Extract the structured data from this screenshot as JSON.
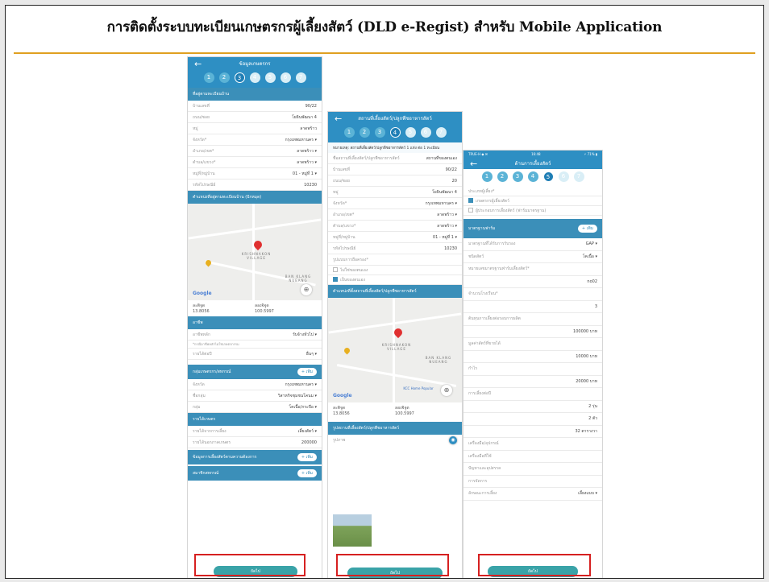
{
  "title": "การติดตั้งระบบทะเบียนเกษตรกรผู้เลี้ยงสัตว์ (DLD e-Regist) สำหรับ Mobile Application",
  "colors": {
    "accent": "#2e8fc3",
    "rule": "#e0a020",
    "highlight": "#d62020",
    "cta": "#3aa3a8"
  },
  "phone1": {
    "header": "ข้อมูลเกษตรกร",
    "steps": [
      "1",
      "2",
      "3",
      "4",
      "5",
      "6",
      "7"
    ],
    "current_step": 3,
    "section_address": "ที่อยู่ตามทะเบียนบ้าน",
    "fields": [
      {
        "label": "บ้านเลขที่",
        "value": "90/22"
      },
      {
        "label": "ถนน/ซอย",
        "value": "โยธินพัฒนา 4"
      },
      {
        "label": "หมู่",
        "value": "ลาดพร้าว"
      },
      {
        "label": "จังหวัด*",
        "value": "กรุงเทพมหานคร ▾"
      },
      {
        "label": "อำเภอ/เขต*",
        "value": "ลาดพร้าว ▾"
      },
      {
        "label": "ตำบล/แขวง*",
        "value": "ลาดพร้าว ▾"
      },
      {
        "label": "หมู่ที่/หมู่บ้าน",
        "value": "01 - หมู่ที่ 1 ▾"
      },
      {
        "label": "รหัสไปรษณีย์",
        "value": "10230"
      }
    ],
    "section_map": "ตำแหน่งที่อยู่ตามทะเบียนบ้าน (ปักหมุด)",
    "map_label": "KRISHNAKON VILLAGE",
    "map_label2": "BAN KLANG NUEANG",
    "google": "Google",
    "lat_label": "ละติจูด",
    "lat": "13.8056",
    "lng_label": "ลองจิจูด",
    "lng": "100.5997",
    "section_other": "อาชีพ",
    "f_job": {
      "label": "อาชีพหลัก",
      "value": "รับจ้างทั่วไป ▾"
    },
    "f_job_note": "*กรณีอาชีพหลักไม่ใช่เกษตรกรรม",
    "f_income": {
      "label": "รายได้ต่อปี",
      "value": "อื่นๆ ▾"
    },
    "section_group": "กลุ่มเกษตรกร/สหกรณ์",
    "add_label": "+ เพิ่ม",
    "fields2": [
      {
        "label": "จังหวัด",
        "value": "กรุงเทพมหานคร ▾"
      },
      {
        "label": "ชื่อกลุ่ม",
        "value": "วิสาหกิจชุมชนโคนม ▾"
      },
      {
        "label": "กลุ่ม",
        "value": "โคเนื้อ/กระบือ ▾"
      }
    ],
    "section_income": "รายได้เกษตร",
    "fields3": [
      {
        "label": "รายได้จากการเลี้ยง",
        "value": "เลี้ยงสัตว์ ▾"
      },
      {
        "label": "รายได้นอกภาคเกษตร",
        "value": "200000"
      }
    ],
    "section_more1": "ข้อมูลการเลี้ยงสัตว์ตามความต้องการ",
    "section_more2": "สมาชิกสหกรณ์",
    "cta": "ถัดไป"
  },
  "phone2": {
    "header": "สถานที่เลี้ยงสัตว์/ปลูกพืชอาหารสัตว์",
    "steps": [
      "1",
      "2",
      "3",
      "4",
      "5",
      "6",
      "7"
    ],
    "current_step": 4,
    "note": "หมายเหตุ: สถานที่เลี้ยงสัตว์/ปลูกพืชอาหารสัตว์ 1 แห่ง ต่อ 1 ทะเบียน",
    "f_type": {
      "label": "ชื่อสถานที่เลี้ยงสัตว์/ปลูกพืชอาหารสัตว์",
      "value": "สถานที่ของตนเอง"
    },
    "fields": [
      {
        "label": "บ้านเลขที่",
        "value": "90/22"
      },
      {
        "label": "ถนน/ซอย",
        "value": "20"
      },
      {
        "label": "หมู่",
        "value": "โยธินพัฒนา 4"
      },
      {
        "label": "จังหวัด*",
        "value": "กรุงเทพมหานคร ▾"
      },
      {
        "label": "อำเภอ/เขต*",
        "value": "ลาดพร้าว ▾"
      },
      {
        "label": "ตำบล/แขวง*",
        "value": "ลาดพร้าว ▾"
      },
      {
        "label": "หมู่ที่/หมู่บ้าน",
        "value": "01 - หมู่ที่ 1 ▾"
      },
      {
        "label": "รหัสไปรษณีย์",
        "value": "10230"
      }
    ],
    "f_owner": "รูปแบบการถือครอง*",
    "opt1": "ไม่ใช่ของตนเอง",
    "opt2": "เป็นของตนเอง",
    "section_map": "ตำแหน่งที่ตั้งสถานที่เลี้ยงสัตว์/ปลูกพืชอาหารสัตว์",
    "map_label": "KRISHNAKON VILLAGE",
    "map_label2": "BAN KLANG NUEANG",
    "map_poi": "KCC Home Popular",
    "google": "Google",
    "lat_label": "ละติจูด",
    "lat": "13.8056",
    "lng_label": "ลองจิจูด",
    "lng": "100.5997",
    "section_photo": "รูปสถานที่เลี้ยงสัตว์/ปลูกพืชอาหารสัตว์",
    "photo_label": "รูปภาพ",
    "cta": "ถัดไป"
  },
  "phone3": {
    "statusbar_left": "TRUE-H ◆ ✉",
    "statusbar_time": "16:48",
    "statusbar_right": "⚡ 71% ▮",
    "header": "ด้านการเลี้ยงสัตว์",
    "steps": [
      "1",
      "2",
      "3",
      "4",
      "5",
      "6",
      "7"
    ],
    "current_step": 5,
    "f_kind": "ประเภทผู้เลี้ยง*",
    "opt1": "เกษตรกรผู้เลี้ยงสัตว์",
    "opt2": "ผู้ประกอบการเลี้ยงสัตว์ (ฟาร์มมาตรฐาน)",
    "section_std": "มาตรฐานฟาร์ม",
    "add_label": "+ เพิ่ม",
    "fields": [
      {
        "label": "มาตรฐานที่ได้รับการรับรอง",
        "value": "GAP ▾"
      },
      {
        "label": "ชนิดสัตว์",
        "value": "โคเนื้อ ▾"
      },
      {
        "label": "หมายเลขมาตรฐานฟาร์มเลี้ยงสัตว์*",
        "value": ""
      },
      {
        "label": "",
        "value": "no02"
      },
      {
        "label": "จำนวนโรงเรือน*",
        "value": ""
      },
      {
        "label": "",
        "value": "3"
      },
      {
        "label": "ต้นทุนการเลี้ยงต่อรอบการผลิต",
        "value": ""
      },
      {
        "label": "",
        "value": "100000  บาท"
      },
      {
        "label": "มูลค่าสัตว์ที่ขายได้",
        "value": ""
      },
      {
        "label": "",
        "value": "10000  บาท"
      },
      {
        "label": "กำไร",
        "value": ""
      },
      {
        "label": "",
        "value": "20000  บาท"
      },
      {
        "label": "การเลี้ยงต่อปี",
        "value": ""
      },
      {
        "label": "",
        "value": "2  รุ่น"
      },
      {
        "label": "",
        "value": "2  ตัว"
      },
      {
        "label": "",
        "value": "32  ตารางวา"
      },
      {
        "label": "เครื่องมือ/อุปกรณ์",
        "value": ""
      },
      {
        "label": "เครื่องมือที่ใช้",
        "value": ""
      },
      {
        "label": "ปัญหาและอุปสรรค",
        "value": ""
      },
      {
        "label": "การจัดการ",
        "value": ""
      },
      {
        "label": "ลักษณะการเลี้ยง",
        "value": "เลี้ยงแบบ ▾"
      }
    ],
    "cta": "ถัดไป"
  }
}
